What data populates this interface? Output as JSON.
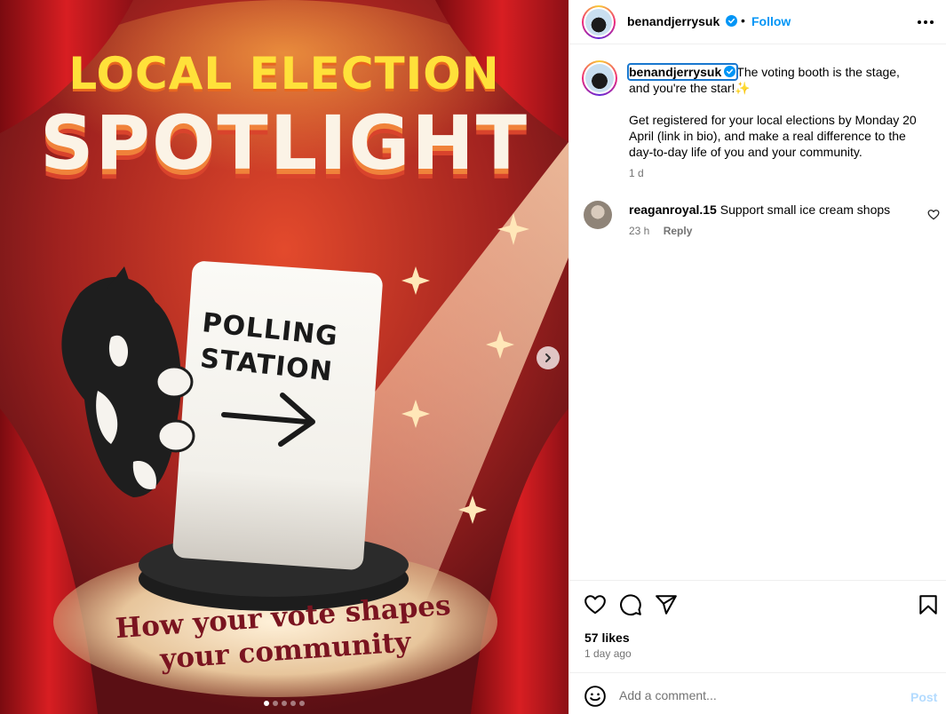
{
  "image": {
    "headline_line1": "LOCAL ELECTION",
    "headline_line2": "SPOTLIGHT",
    "sign_line1": "POLLING",
    "sign_line2": "STATION",
    "tagline_line1": "How your vote shapes",
    "tagline_line2": "your community",
    "carousel_dots": 5,
    "carousel_active_index": 0
  },
  "header": {
    "username": "benandjerrysuk",
    "separator": "•",
    "follow_label": "Follow"
  },
  "caption": {
    "username": "benandjerrysuk",
    "text_line1": "The voting booth is the stage, and you're the star!",
    "sparkle": "✨",
    "text_para2": "Get registered for your local elections by Monday 20 April (link in bio), and make a real difference to the day-to-day life of you and your community.",
    "time": "1 d"
  },
  "comments": [
    {
      "username": "reaganroyal.15",
      "text": "Support small ice cream shops",
      "time": "23 h",
      "reply_label": "Reply"
    }
  ],
  "actions": {
    "likes": "57 likes",
    "posted_ago": "1 day ago"
  },
  "add_comment": {
    "placeholder": "Add a comment...",
    "post_label": "Post"
  },
  "colors": {
    "follow": "#0095f6",
    "verified": "#0095f6",
    "post_disabled": "#b3dbff",
    "headline_yellow": "#ffe13a",
    "curtain_red": "#c3161c"
  }
}
